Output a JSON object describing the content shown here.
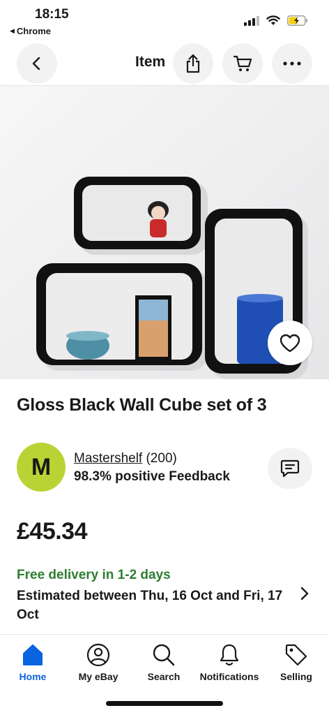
{
  "status_bar": {
    "time": "18:15",
    "back_app": "Chrome",
    "icons": [
      "signal-icon",
      "wifi-icon",
      "battery-charging-icon"
    ]
  },
  "header": {
    "title": "Item",
    "buttons": [
      "back-icon",
      "share-icon",
      "cart-icon",
      "more-icon"
    ]
  },
  "product": {
    "title": "Gloss Black Wall Cube set of 3",
    "price": "£45.34"
  },
  "seller": {
    "initial": "M",
    "name": "Mastershelf",
    "rating_count": "(200)",
    "feedback": "98.3% positive Feedback",
    "avatar_color": "#b9d334"
  },
  "delivery": {
    "free_text": "Free delivery in 1-2 days",
    "estimate": "Estimated between Thu, 16 Oct and Fri, 17 Oct",
    "free_color": "#2e7d32"
  },
  "tabbar": {
    "tabs": [
      {
        "label": "Home",
        "icon": "home-icon",
        "active": true
      },
      {
        "label": "My eBay",
        "icon": "user-circle-icon",
        "active": false
      },
      {
        "label": "Search",
        "icon": "search-icon",
        "active": false
      },
      {
        "label": "Notifications",
        "icon": "bell-icon",
        "active": false
      },
      {
        "label": "Selling",
        "icon": "tag-icon",
        "active": false
      }
    ],
    "active_color": "#0a64e1"
  }
}
